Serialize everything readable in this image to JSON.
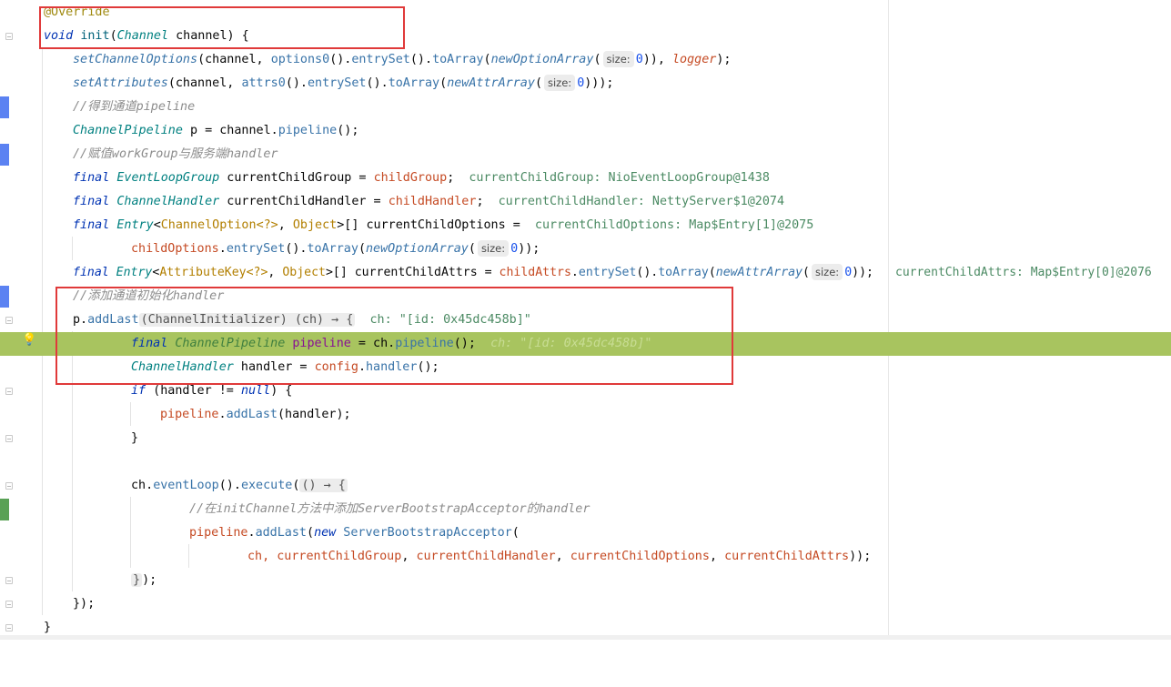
{
  "editor": {
    "gutter_markers": [
      {
        "color": "blue"
      },
      {
        "color": "blue"
      },
      {
        "color": "blue"
      },
      {
        "color": "green"
      }
    ],
    "execution_line_hint": "ch: \"[id: 0x45dc458b]\""
  },
  "code": {
    "l1": {
      "annotation": "@Override"
    },
    "l2": {
      "kw_void": "void",
      "method": "init",
      "param_type": "Channel",
      "rest": " channel) {",
      "open": "("
    },
    "l3": {
      "call": "setChannelOptions",
      "a1": "(channel, ",
      "opt0": "options0",
      "a2": "().",
      "entrySet": "entrySet",
      "a3": "().",
      "toArray": "toArray",
      "a4": "(",
      "newArr": "newOptionArray",
      "a5": "(",
      "hint": "size:",
      "zero": "0",
      "a6": ")), ",
      "logger": "logger",
      "a7": ");"
    },
    "l4": {
      "call": "setAttributes",
      "a1": "(channel, ",
      "attrs0": "attrs0",
      "a2": "().",
      "entrySet": "entrySet",
      "a3": "().",
      "toArray": "toArray",
      "a4": "(",
      "newArr": "newAttrArray",
      "a5": "(",
      "hint": "size:",
      "zero": "0",
      "a6": ")));"
    },
    "l5": {
      "comment": "//得到通道pipeline"
    },
    "l6": {
      "type": "ChannelPipeline",
      "var": " p = channel.",
      "pipeline": "pipeline",
      "end": "();"
    },
    "l7": {
      "comment": "//赋值workGroup与服务端handler"
    },
    "l8": {
      "final": "final",
      "type": "EventLoopGroup",
      "var": " currentChildGroup = ",
      "field": "childGroup",
      "end": ";",
      "debug": "currentChildGroup: NioEventLoopGroup@1438"
    },
    "l9": {
      "final": "final",
      "type": "ChannelHandler",
      "var": " currentChildHandler = ",
      "field": "childHandler",
      "end": ";",
      "debug": "currentChildHandler: NettyServer$1@2074"
    },
    "l10": {
      "final": "final",
      "type": "Entry",
      "lt": "<",
      "opt": "ChannelOption",
      "q": "<?>",
      "c": ", ",
      "obj": "Object",
      "gt": ">[] currentChildOptions = ",
      "debug": "currentChildOptions: Map$Entry[1]@2075"
    },
    "l11": {
      "field": "childOptions",
      "d1": ".",
      "entrySet": "entrySet",
      "d2": "().",
      "toArray": "toArray",
      "d3": "(",
      "newArr": "newOptionArray",
      "d4": "(",
      "hint": "size:",
      "zero": "0",
      "end": "));"
    },
    "l12": {
      "final": "final",
      "type": "Entry",
      "lt": "<",
      "key": "AttributeKey",
      "q": "<?>",
      "c": ", ",
      "obj": "Object",
      "gt": ">[] currentChildAttrs = ",
      "field": "childAttrs",
      "d1": ".",
      "entrySet": "entrySet",
      "d2": "().",
      "toArray": "toArray",
      "d3": "(",
      "newArr": "newAttrArray",
      "d4": "(",
      "hint": "size:",
      "zero": "0",
      "end": "));",
      "debug": "currentChildAttrs: Map$Entry[0]@2076"
    },
    "l13": {
      "comment": "//添加通道初始化handler"
    },
    "l14": {
      "p": "p.",
      "addLast": "addLast",
      "lambda": "(ChannelInitializer) (ch) → {",
      "debug": "ch: \"[id: 0x45dc458b]\""
    },
    "l15": {
      "final": "final",
      "type": "ChannelPipeline",
      "var": " pipeline",
      "eq": " = ch.",
      "pipeline": "pipeline",
      "end": "();"
    },
    "l16": {
      "type": "ChannelHandler",
      "var": " handler = ",
      "config": "config",
      "d": ".",
      "handler": "handler",
      "end": "();"
    },
    "l17": {
      "if": "if",
      "a": " (handler != ",
      "null": "null",
      "b": ") {"
    },
    "l18": {
      "pipeline": "pipeline",
      "d": ".",
      "addLast": "addLast",
      "end": "(handler);"
    },
    "l19": {
      "brace": "}"
    },
    "l21": {
      "ch": "ch.",
      "eventLoop": "eventLoop",
      "d": "().",
      "execute": "execute",
      "a": "(",
      "lambda": "() → {"
    },
    "l22": {
      "comment": "//在initChannel方法中添加ServerBootstrapAcceptor的handler"
    },
    "l23": {
      "pipeline": "pipeline",
      "d": ".",
      "addLast": "addLast",
      "a": "(",
      "new": "new",
      "cls": " ServerBootstrapAcceptor",
      "b": "("
    },
    "l24": {
      "ch": "ch, ",
      "g": "currentChildGroup",
      "c1": ", ",
      "h": "currentChildHandler",
      "c2": ", ",
      "o": "currentChildOptions",
      "c3": ", ",
      "a": "currentChildAttrs",
      "end": "));"
    },
    "l25": {
      "brace": "});",
      "b1": "}",
      "b2": ");"
    },
    "l26": {
      "end": "});"
    },
    "l27": {
      "brace": "}"
    }
  }
}
